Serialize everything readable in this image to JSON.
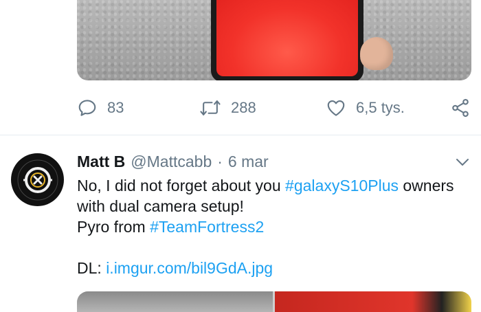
{
  "previous_tweet": {
    "reply_count": "83",
    "retweet_count": "288",
    "like_count": "6,5 tys."
  },
  "tweet": {
    "display_name": "Matt B",
    "handle": "@Mattcabb",
    "separator": "·",
    "date": "6 mar",
    "text_1a": "No, I did not forget about you ",
    "hashtag_1": "#galaxyS10Plus",
    "text_1b": " owners",
    "text_2": "with dual camera setup!",
    "text_3a": "Pyro from ",
    "hashtag_2": "#TeamFortress2",
    "text_4a": "DL: ",
    "link": "i.imgur.com/bil9GdA.jpg"
  },
  "icons": {
    "reply": "reply-icon",
    "retweet": "retweet-icon",
    "like": "heart-icon",
    "share": "share-icon",
    "more": "chevron-down-icon"
  },
  "colors": {
    "accent": "#1da1f2",
    "muted": "#657786",
    "text": "#14171a",
    "divider": "#e6ecf0"
  }
}
